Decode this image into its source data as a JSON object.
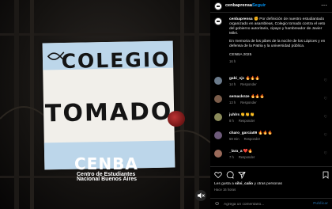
{
  "post": {
    "banner_line1": "COLEGIO",
    "banner_line2": "TOMADO",
    "watermark_title": "CENBA",
    "watermark_sub1": "Centro de Estudiantes",
    "watermark_sub2": "Nacional Buenos Aires",
    "banner_stripe_color": "#bcd6ea"
  },
  "header": {
    "username": "cenbaprensa",
    "separator": "•",
    "follow_label": "Seguir",
    "more_icon": "more-horizontal-icon"
  },
  "caption": {
    "username": "cenbaprensa",
    "paragraph1": "✊ Por definición de nuestro estudiantado organizado en asambleas, Colegio tomado contra el veto del gobierno autoritario, cipayo y hambreador de Javier Milei.",
    "paragraph2": "En memoria de los pibes de la noche de los Lápices y en defensa de la Patria y la universidad pública.",
    "paragraph3": "CENBA 2025",
    "time": "16 h"
  },
  "comments": [
    {
      "username": "gabi_sjc",
      "text": "🔥🔥🔥",
      "time": "14 h",
      "reply": "Responder",
      "avatar_color": "#6b7b8c"
    },
    {
      "username": "semacknze",
      "text": "🔥🔥🔥",
      "time": "13 h",
      "reply": "Responder",
      "avatar_color": "#7a5c4a"
    },
    {
      "username": "juhlrs",
      "text": "👏👏👏",
      "time": "8 h",
      "reply": "Responder",
      "avatar_color": "#8a8a5a"
    },
    {
      "username": "charo_garcia09",
      "text": "🔥🔥🔥",
      "time": "59 min",
      "reply": "Responder",
      "avatar_color": "#6d5a7a"
    },
    {
      "username": "_lara_a",
      "text": "❤️🔥",
      "time": "7 h",
      "reply": "Responder",
      "avatar_color": "#9a6a5a"
    }
  ],
  "footer": {
    "likes_prefix": "Les gusta a",
    "likes_user": "silvi_calio",
    "likes_suffix": "y otras personas",
    "posted_time": "Hace 16 horas",
    "comment_placeholder": "Agrega un comentario...",
    "publish_label": "Publicar",
    "icons": [
      "heart-icon",
      "comment-icon",
      "share-icon",
      "bookmark-icon"
    ]
  }
}
